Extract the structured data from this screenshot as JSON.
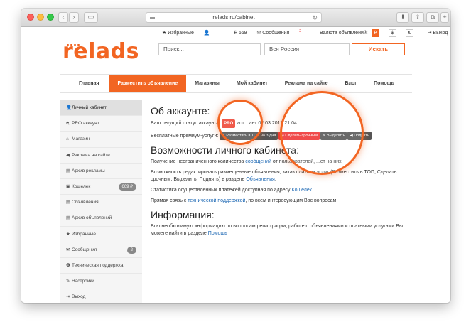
{
  "browser": {
    "url": "relads.ru/cabinet",
    "back": "‹",
    "forward": "›"
  },
  "header": {
    "logo": "relads",
    "favorites": "★ Избранные",
    "user_icon": "👤",
    "balance": "₽ 669",
    "messages": "✉ Сообщения",
    "messages_count": "2",
    "currency_label": "Валюта объявлений:",
    "currencies": [
      "₽",
      "$",
      "€"
    ],
    "logout": "⇥ Выход",
    "search_placeholder": "Поиск...",
    "region": "Вся Россия",
    "search_button": "Искать"
  },
  "nav": [
    "Главная",
    "Разместить объявление",
    "Магазины",
    "Мой кабинет",
    "Реклама на сайте",
    "Блог",
    "Помощь"
  ],
  "sidebar": [
    {
      "icon": "👤",
      "label": "Личный кабинет"
    },
    {
      "icon": "⛐",
      "label": "PRO аккаунт"
    },
    {
      "icon": "⌂",
      "label": "Магазин"
    },
    {
      "icon": "◀",
      "label": "Реклама на сайте"
    },
    {
      "icon": "▤",
      "label": "Архив рекламы"
    },
    {
      "icon": "▣",
      "label": "Кошелек",
      "badge": "669 ₽"
    },
    {
      "icon": "▤",
      "label": "Объявления"
    },
    {
      "icon": "▤",
      "label": "Архив объявлений"
    },
    {
      "icon": "★",
      "label": "Избранные"
    },
    {
      "icon": "✉",
      "label": "Сообщения",
      "badge": "2"
    },
    {
      "icon": "❶",
      "label": "Техническая поддержка"
    },
    {
      "icon": "✎",
      "label": "Настройки"
    },
    {
      "icon": "⇥",
      "label": "Выход"
    }
  ],
  "main": {
    "about_title": "Об аккаунте:",
    "status_prefix": "Ваш текущий статус аккаунта:",
    "status_badge": "PRO",
    "status_suffix": "ист... ает 02.03.2017 21:04",
    "free_services": "Бесплатные премиум-услуги:",
    "service_top": "⬆ Разместить в ТОП на 3 дня",
    "service_urgent": "⊘ Сделать срочным",
    "service_highlight": "✎ Выделить",
    "service_raise": "◀ Поднять",
    "features_title": "Возможности личного кабинета:",
    "f1_a": "Получение неограниченного количества",
    "f1_link": "сообщений",
    "f1_b": "от пользователей, ...ет на них.",
    "f2_a": "Возможность редактировать размещенные объявления, заказ платных услуг (Разместить в ТОП, Сделать срочным, Выделить, Поднять) в разделе",
    "f2_link": "Объявления",
    "f3_a": "Статистика осуществленных платежей доступная по адресу",
    "f3_link": "Кошелек",
    "f4_a": "Прямая связь с",
    "f4_link": "технической поддержкой",
    "f4_b": ", по всем интересующим Вас вопросам.",
    "info_title": "Информация:",
    "info_a": "Всю необходимую информацию по вопросам регистрации, работе с объявлениями и платными услугами Вы можете найти в разделе",
    "info_link": "Помощь"
  }
}
